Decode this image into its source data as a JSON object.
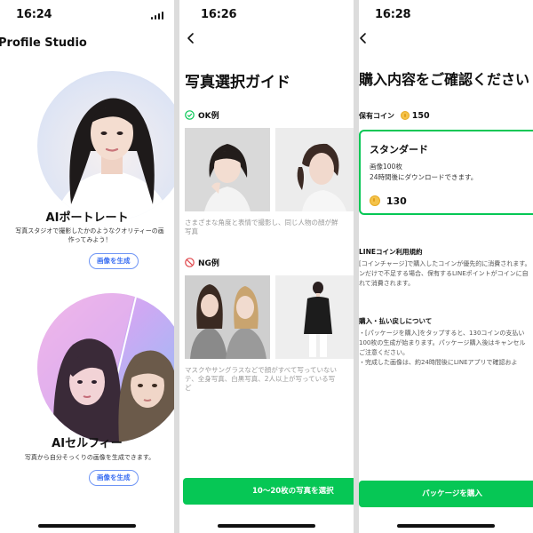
{
  "panel1": {
    "time": "16:24",
    "app_title": "Profile Studio",
    "card1": {
      "title": "AIポートレート",
      "desc_line1": "写真スタジオで撮影したかのようなクオリティーの画",
      "desc_line2": "作ってみよう！",
      "button": "画像を生成"
    },
    "card2": {
      "title": "AIセルフィー",
      "desc": "写真から自分そっくりの画像を生成できます。",
      "button": "画像を生成"
    }
  },
  "panel2": {
    "time": "16:26",
    "title": "写真選択ガイド",
    "ok_label": "OK例",
    "ok_caption_line1": "さまざまな角度と表情で撮影し、同じ人物の顔が鮮",
    "ok_caption_line2": "写真",
    "ng_label": "NG例",
    "ng_caption_line1": "マスクやサングラスなどで顔がすべて写っていない",
    "ng_caption_line2": "テ、全身写真、白黒写真、2人以上が写っている写",
    "ng_caption_line3": "ど",
    "select_button": "10〜20枚の写真を選択"
  },
  "panel3": {
    "time": "16:28",
    "title": "購入内容をご確認ください",
    "coin_label": "保有コイン",
    "coin_balance": "150",
    "package": {
      "name": "スタンダード",
      "line1": "画像100枚",
      "line2": "24時間後にダウンロードできます。",
      "price": "130"
    },
    "terms_heading": "LINEコイン利用規約",
    "terms_line1": "[コインチャージ]で購入したコインが優先的に消費されます。",
    "terms_line2": "ンだけで不足する場合、保有するLINEポイントがコインに自",
    "terms_line3": "れて消費されます。",
    "refund_heading": "購入・払い戻しについて",
    "refund_line1": "・[パッケージを購入]をタップすると、130コインの支払い",
    "refund_line2": "100枚の生成が始まります。パッケージ購入後はキャンセル",
    "refund_line3": "ご注意ください。",
    "refund_line4": "・完成した画像は、約24時間後にLINEアプリで確認およ",
    "buy_button": "パッケージを購入"
  },
  "colors": {
    "line_green": "#06c755",
    "link_blue": "#3b6ff2",
    "ok_green": "#06c755",
    "ng_red": "#e0474c",
    "coin_gold": "#f4c34a"
  },
  "icons": [
    "signal-icon",
    "back-chevron-icon",
    "ok-check-icon",
    "ng-prohibited-icon",
    "coin-icon"
  ]
}
